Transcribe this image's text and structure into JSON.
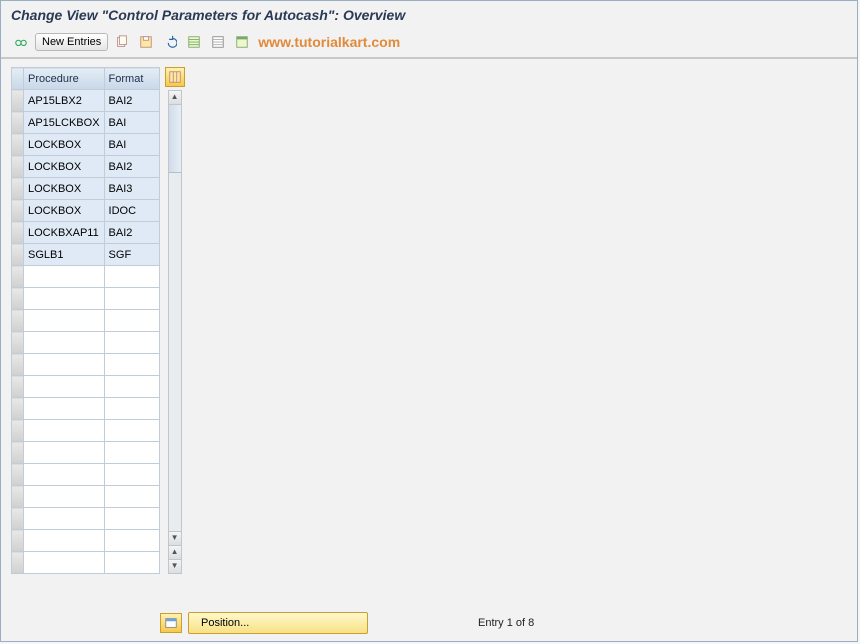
{
  "title": "Change View \"Control Parameters for Autocash\": Overview",
  "toolbar": {
    "new_entries_label": "New Entries",
    "watermark": "www.tutorialkart.com"
  },
  "table": {
    "headers": {
      "procedure": "Procedure",
      "format": "Format"
    },
    "rows": [
      {
        "procedure": "AP15LBX2",
        "format": "BAI2"
      },
      {
        "procedure": "AP15LCKBOX",
        "format": "BAI"
      },
      {
        "procedure": "LOCKBOX",
        "format": "BAI"
      },
      {
        "procedure": "LOCKBOX",
        "format": "BAI2"
      },
      {
        "procedure": "LOCKBOX",
        "format": "BAI3"
      },
      {
        "procedure": "LOCKBOX",
        "format": "IDOC"
      },
      {
        "procedure": "LOCKBXAP11",
        "format": "BAI2"
      },
      {
        "procedure": "SGLB1",
        "format": "SGF"
      }
    ],
    "empty_row_count": 14
  },
  "footer": {
    "position_label": "Position...",
    "entry_text": "Entry 1 of 8"
  }
}
